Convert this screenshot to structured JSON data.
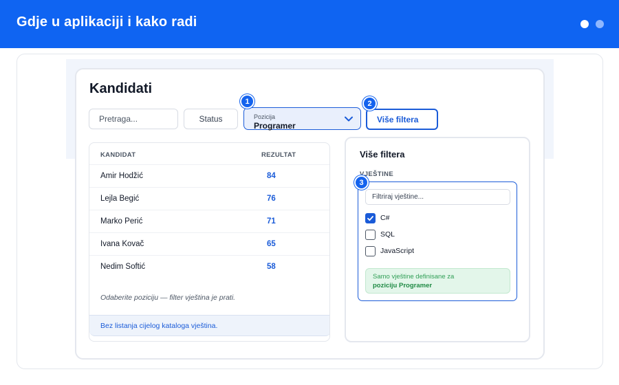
{
  "header": {
    "title": "Gdje u aplikaciji i kako radi",
    "colors": {
      "bar": "#0f64f2",
      "dot_active": "#ffffff",
      "dot_inactive": "#8fb7ff"
    }
  },
  "page": {
    "title": "Kandidati"
  },
  "filters": {
    "search_placeholder": "Pretraga...",
    "status_label": "Status",
    "position_label": "Pozicija",
    "position_value": "Programer",
    "more_filters_label": "Više filtera"
  },
  "badges": [
    "1",
    "2",
    "3"
  ],
  "table": {
    "columns": [
      "KANDIDAT",
      "REZULTAT"
    ],
    "rows": [
      {
        "name": "Amir Hodžić",
        "score": "84"
      },
      {
        "name": "Lejla Begić",
        "score": "76"
      },
      {
        "name": "Marko Perić",
        "score": "71"
      },
      {
        "name": "Ivana Kovač",
        "score": "65"
      },
      {
        "name": "Nedim Softić",
        "score": "58"
      }
    ],
    "hint": "Odaberite poziciju — filter vještina je prati.",
    "info": "Bez listanja cijelog kataloga vještina."
  },
  "more_filters_panel": {
    "title": "Više filtera",
    "section": "VJEŠTINE",
    "skill_filter_placeholder": "Filtriraj vještine...",
    "skills": [
      {
        "label": "C#",
        "checked": true
      },
      {
        "label": "SQL",
        "checked": false
      },
      {
        "label": "JavaScript",
        "checked": false
      }
    ],
    "note_line1": "Samo vještine definisane za",
    "note_line2": "poziciju Programer"
  },
  "accent_color": "#1a5bd8"
}
